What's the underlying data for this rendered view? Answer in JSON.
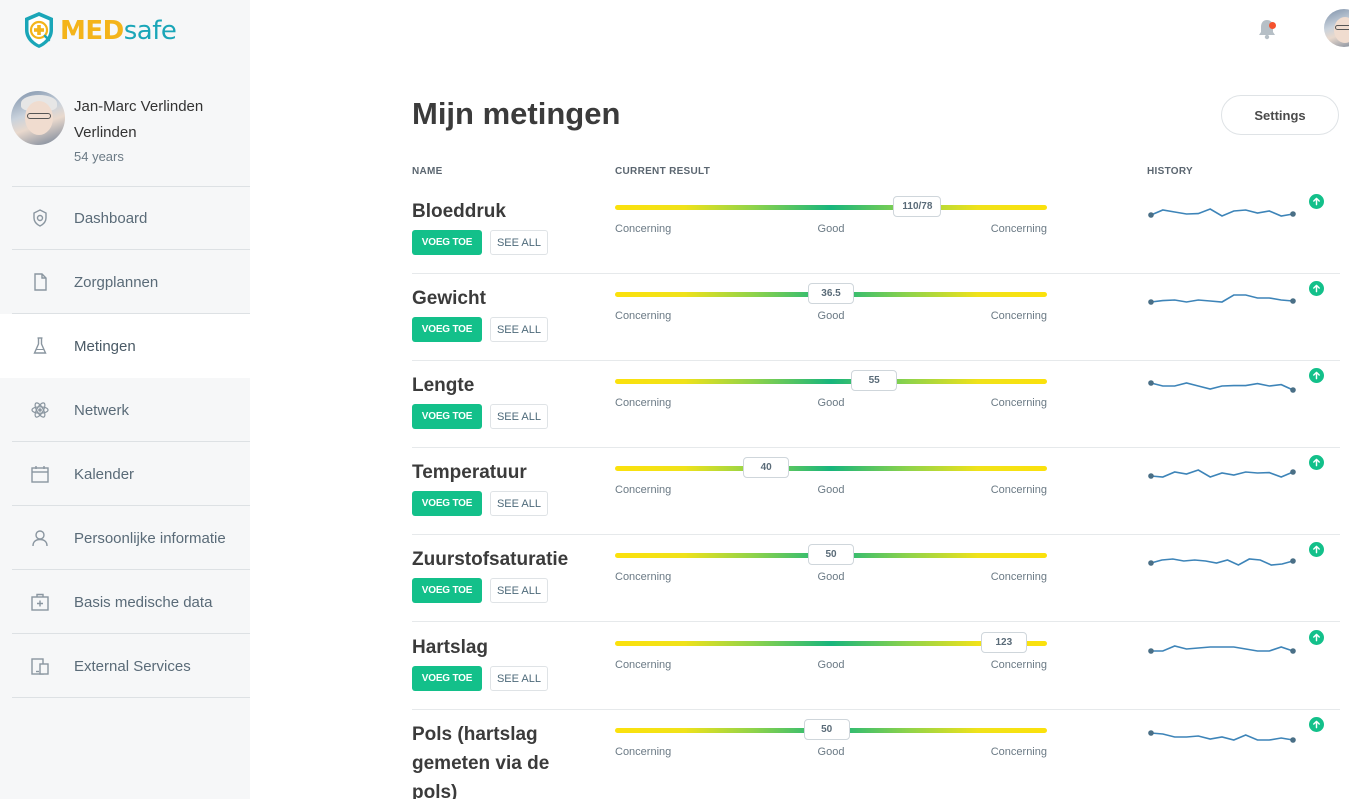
{
  "app": {
    "logo_med": "MED",
    "logo_safe": "safe"
  },
  "colors": {
    "brand_green": "#13c08a",
    "logo_yellow": "#f4b41a",
    "logo_teal": "#1aa6b8",
    "notification_dot": "#f4522e"
  },
  "profile": {
    "name": "Jan-Marc Verlinden Verlinden",
    "age": "54 years"
  },
  "nav": [
    {
      "label": "Dashboard",
      "icon": "shield-icon",
      "active": false
    },
    {
      "label": "Zorgplannen",
      "icon": "document-icon",
      "active": false
    },
    {
      "label": "Metingen",
      "icon": "flask-icon",
      "active": true
    },
    {
      "label": "Netwerk",
      "icon": "atom-icon",
      "active": false
    },
    {
      "label": "Kalender",
      "icon": "calendar-icon",
      "active": false
    },
    {
      "label": "Persoonlijke informatie",
      "icon": "user-icon",
      "active": false
    },
    {
      "label": "Basis medische data",
      "icon": "medkit-icon",
      "active": false
    },
    {
      "label": "External Services",
      "icon": "devices-icon",
      "active": false
    }
  ],
  "header": {
    "notification_icon": "bell-icon"
  },
  "main": {
    "title": "Mijn metingen",
    "settings_label": "Settings",
    "columns": {
      "name": "NAME",
      "current": "CURRENT RESULT",
      "history": "HISTORY"
    },
    "add_label": "VOEG TOE",
    "see_all_label": "SEE ALL",
    "scale_labels": {
      "left": "Concerning",
      "mid": "Good",
      "right": "Concerning"
    },
    "measurements": [
      {
        "name": "Bloeddruk",
        "value": "110/78",
        "position": 0.7,
        "history": [
          0.55,
          0.3,
          0.4,
          0.5,
          0.48,
          0.25,
          0.6,
          0.35,
          0.3,
          0.45,
          0.35,
          0.6,
          0.5
        ]
      },
      {
        "name": "Gewicht",
        "value": "36.5",
        "position": 0.5,
        "history": [
          0.55,
          0.48,
          0.45,
          0.55,
          0.45,
          0.5,
          0.55,
          0.2,
          0.2,
          0.35,
          0.35,
          0.45,
          0.5
        ]
      },
      {
        "name": "Lengte",
        "value": "55",
        "position": 0.6,
        "history": [
          0.25,
          0.4,
          0.4,
          0.25,
          0.4,
          0.55,
          0.4,
          0.38,
          0.38,
          0.28,
          0.4,
          0.33,
          0.6
        ]
      },
      {
        "name": "Temperatuur",
        "value": "40",
        "position": 0.35,
        "history": [
          0.55,
          0.6,
          0.35,
          0.45,
          0.25,
          0.6,
          0.4,
          0.5,
          0.35,
          0.4,
          0.38,
          0.6,
          0.35
        ]
      },
      {
        "name": "Zuurstofsaturatie",
        "value": "50",
        "position": 0.5,
        "history": [
          0.55,
          0.4,
          0.35,
          0.45,
          0.4,
          0.45,
          0.55,
          0.4,
          0.65,
          0.35,
          0.4,
          0.65,
          0.6,
          0.45
        ]
      },
      {
        "name": "Hartslag",
        "value": "123",
        "position": 0.9,
        "history": [
          0.55,
          0.55,
          0.3,
          0.45,
          0.4,
          0.35,
          0.35,
          0.35,
          0.45,
          0.55,
          0.55,
          0.35,
          0.55
        ]
      },
      {
        "name": "Pols (hartslag gemeten via de pols)",
        "value": "50",
        "position": 0.49,
        "history": [
          0.3,
          0.35,
          0.5,
          0.5,
          0.45,
          0.6,
          0.5,
          0.65,
          0.4,
          0.65,
          0.65,
          0.55,
          0.65
        ]
      }
    ]
  }
}
